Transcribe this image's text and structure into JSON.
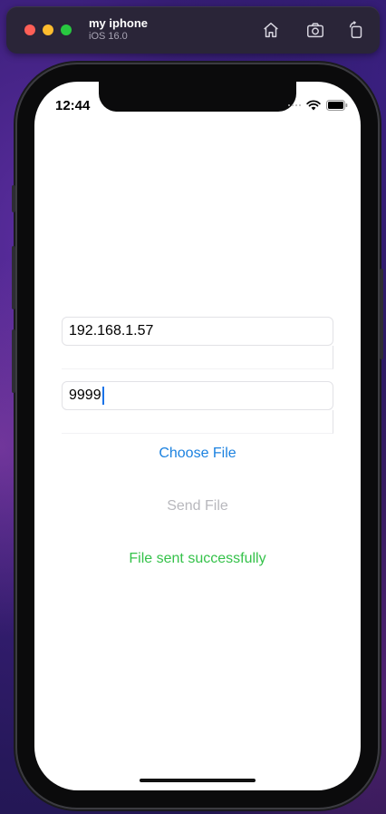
{
  "simulator": {
    "device_name": "my iphone",
    "os_version": "iOS 16.0",
    "tools": [
      "home-icon",
      "screenshot-icon",
      "rotate-icon"
    ]
  },
  "status_bar": {
    "time": "12:44"
  },
  "form": {
    "ip_value": "192.168.1.57",
    "port_value": "9999",
    "choose_file_label": "Choose File",
    "send_file_label": "Send File",
    "status_message": "File sent successfully"
  },
  "colors": {
    "link_blue": "#1c82e0",
    "disabled_gray": "#b8b8bd",
    "success_green": "#35c24a"
  }
}
